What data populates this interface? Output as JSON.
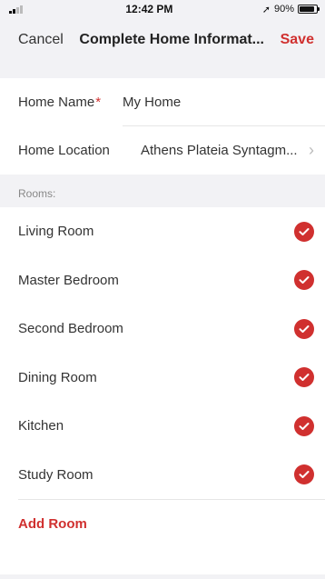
{
  "status_bar": {
    "time": "12:42 PM",
    "battery_text": "90%",
    "battery_level": 0.9
  },
  "nav": {
    "cancel": "Cancel",
    "title": "Complete Home Informat...",
    "save": "Save"
  },
  "home": {
    "name_label": "Home Name",
    "required_mark": "*",
    "name_value": "My Home",
    "location_label": "Home Location",
    "location_value": "Athens Plateia Syntagm..."
  },
  "rooms_label": "Rooms:",
  "rooms": [
    {
      "label": "Living Room",
      "checked": true
    },
    {
      "label": "Master Bedroom",
      "checked": true
    },
    {
      "label": "Second Bedroom",
      "checked": true
    },
    {
      "label": "Dining Room",
      "checked": true
    },
    {
      "label": "Kitchen",
      "checked": true
    },
    {
      "label": "Study Room",
      "checked": true
    }
  ],
  "add_room": "Add Room",
  "colors": {
    "accent": "#d0302f",
    "background": "#f2f2f5"
  }
}
